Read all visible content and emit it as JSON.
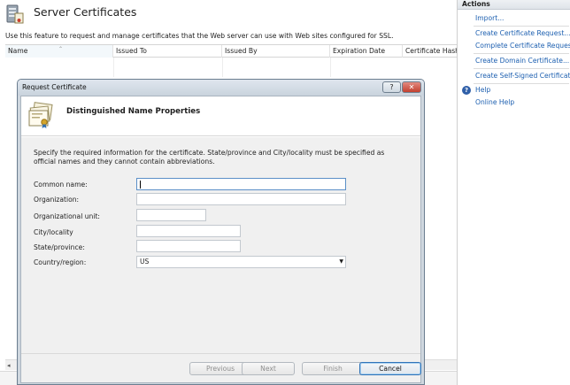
{
  "page": {
    "title": "Server Certificates",
    "description": "Use this feature to request and manage certificates that the Web server can use with Web sites configured for SSL.",
    "columns": [
      "Name",
      "Issued To",
      "Issued By",
      "Expiration Date",
      "Certificate Hash"
    ]
  },
  "actions": {
    "header": "Actions",
    "links": [
      "Import...",
      "Create Certificate Request...",
      "Complete Certificate Request...",
      "Create Domain Certificate...",
      "Create Self-Signed Certificate...",
      "Help",
      "Online Help"
    ]
  },
  "dialog": {
    "title": "Request Certificate",
    "help_button": "?",
    "close_button": "✕",
    "heading": "Distinguished Name Properties",
    "instructions": "Specify the required information for the certificate. State/province and City/locality must be specified as official names and they cannot contain abbreviations.",
    "fields": [
      {
        "label": "Common name:",
        "value": ""
      },
      {
        "label": "Organization:",
        "value": ""
      },
      {
        "label": "Organizational unit:",
        "value": ""
      },
      {
        "label": "City/locality",
        "value": ""
      },
      {
        "label": "State/province:",
        "value": ""
      },
      {
        "label": "Country/region:",
        "value": "US"
      }
    ],
    "buttons": {
      "previous": "Previous",
      "next": "Next",
      "finish": "Finish",
      "cancel": "Cancel"
    }
  }
}
